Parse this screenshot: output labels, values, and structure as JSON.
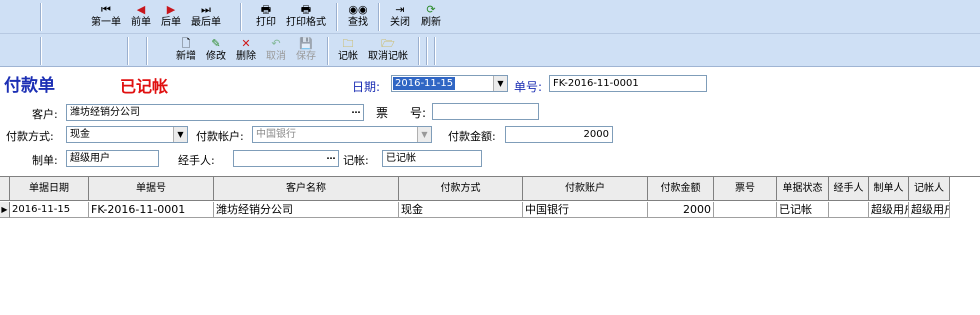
{
  "toolbar1": {
    "first": "第一单",
    "prev": "前单",
    "next": "后单",
    "last": "最后单",
    "print": "打印",
    "print_format": "打印格式",
    "find": "查找",
    "close": "关闭",
    "refresh": "刷新"
  },
  "toolbar2": {
    "new": "新增",
    "edit": "修改",
    "delete": "删除",
    "cancel": "取消",
    "save": "保存",
    "post": "记帐",
    "unpost": "取消记帐"
  },
  "form": {
    "title": "付款单",
    "status": "已记帐",
    "date_label": "日期:",
    "date_value": "2016-11-15",
    "doc_no_label": "单号:",
    "doc_no_value": "FK-2016-11-0001",
    "customer_label": "客户:",
    "customer_value": "潍坊经销分公司",
    "ticket_label": "票",
    "ticket_label2": "号:",
    "ticket_value": "",
    "pay_method_label": "付款方式:",
    "pay_method_value": "现金",
    "pay_account_label": "付款帐户:",
    "pay_account_value": "中国银行",
    "amount_label": "付款金额:",
    "amount_value": "2000",
    "maker_label": "制单:",
    "maker_value": "超级用户",
    "handler_label": "经手人:",
    "handler_value": "",
    "poster_label": "记帐:",
    "poster_value": "已记帐"
  },
  "grid": {
    "columns": [
      "单据日期",
      "单据号",
      "客户名称",
      "付款方式",
      "付款账户",
      "付款金额",
      "票号",
      "单据状态",
      "经手人",
      "制单人",
      "记帐人"
    ],
    "rows": [
      [
        "2016-11-15",
        "FK-2016-11-0001",
        "潍坊经销分公司",
        "现金",
        "中国银行",
        "2000",
        "",
        "已记帐",
        "",
        "超级用户",
        "超级用户"
      ]
    ]
  }
}
